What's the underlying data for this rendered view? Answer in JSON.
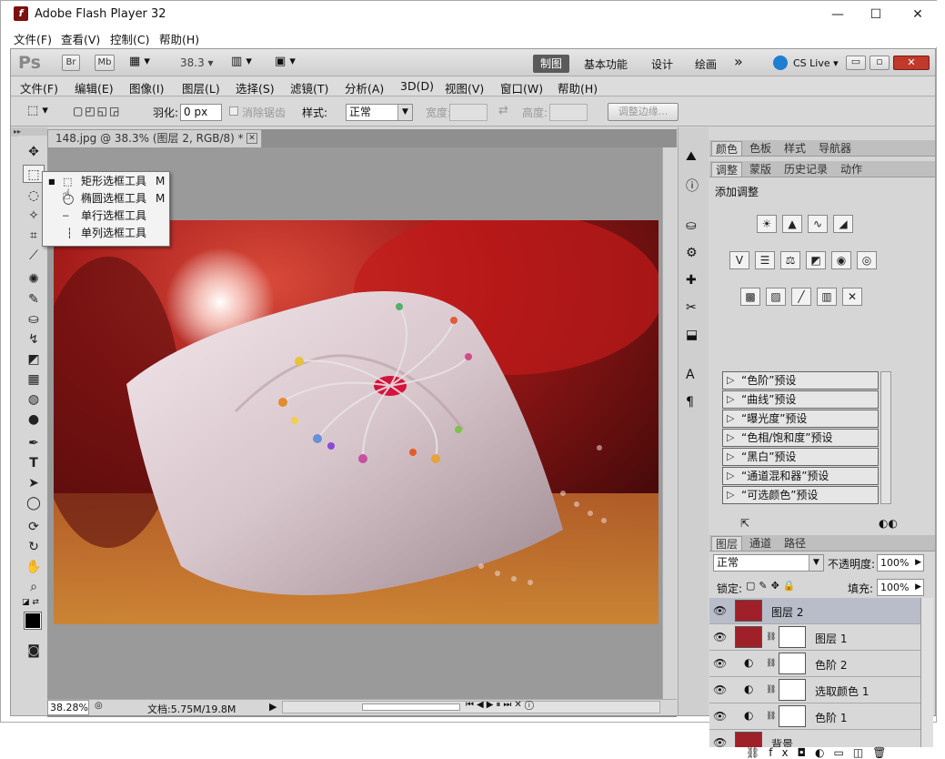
{
  "window": {
    "title": "Adobe Flash Player 32",
    "logo_glyph": "f",
    "minimize_label": "—",
    "maximize_label": "☐",
    "close_label": "✕"
  },
  "app_menu": [
    "文件(F)",
    "查看(V)",
    "控制(C)",
    "帮助(H)"
  ],
  "appbar": {
    "ps_label": "Ps",
    "br_label": "Br",
    "mb_label": "Mb",
    "zoom_value": "38.3",
    "workspaces": [
      "制图",
      "基本功能",
      "设计",
      "绘画"
    ],
    "more_label": "»",
    "cslive_label": "CS Live"
  },
  "menubar": [
    "文件(F)",
    "编辑(E)",
    "图像(I)",
    "图层(L)",
    "选择(S)",
    "滤镜(T)",
    "分析(A)",
    "3D(D)",
    "视图(V)",
    "窗口(W)",
    "帮助(H)"
  ],
  "options": {
    "feather_label": "羽化:",
    "feather_value": "0 px",
    "antialias_label": "消除锯齿",
    "style_label": "样式:",
    "style_value": "正常",
    "width_label": "宽度:",
    "height_label": "高度:",
    "refine_edge_label": "调整边缘..."
  },
  "document": {
    "tab_title": "148.jpg @ 38.3% (图层 2, RGB/8) *",
    "zoom_status": "38.28%",
    "doc_size": "文档:5.75M/19.8M"
  },
  "flyout": {
    "items": [
      {
        "label": "矩形选框工具",
        "shortcut": "M",
        "selected": true
      },
      {
        "label": "椭圆选框工具",
        "shortcut": "M",
        "selected": false
      },
      {
        "label": "单行选框工具",
        "shortcut": "",
        "selected": false
      },
      {
        "label": "单列选框工具",
        "shortcut": "",
        "selected": false
      }
    ]
  },
  "panel_top_tabs": [
    "颜色",
    "色板",
    "样式",
    "导航器"
  ],
  "panel_adj_tabs": [
    "调整",
    "蒙版",
    "历史记录",
    "动作"
  ],
  "adjustments": {
    "title": "添加调整",
    "presets": [
      "“色阶”预设",
      "“曲线”预设",
      "“曝光度”预设",
      "“色相/饱和度”预设",
      "“黑白”预设",
      "“通道混和器”预设",
      "“可选颜色”预设"
    ]
  },
  "layers_tabs": [
    "图层",
    "通道",
    "路径"
  ],
  "layers_panel": {
    "blend_mode": "正常",
    "opacity_label": "不透明度:",
    "opacity_value": "100%",
    "lock_label": "锁定:",
    "fill_label": "填充:",
    "fill_value": "100%",
    "layers": [
      {
        "name": "图层 2",
        "selected": true
      },
      {
        "name": "图层 1",
        "selected": false
      },
      {
        "name": "色阶 2",
        "selected": false
      },
      {
        "name": "选取颜色 1",
        "selected": false
      },
      {
        "name": "色阶 1",
        "selected": false
      },
      {
        "name": "背景",
        "selected": false
      }
    ]
  },
  "colors": {
    "accent_red": "#c8102e",
    "active_workspace": "#555555"
  }
}
